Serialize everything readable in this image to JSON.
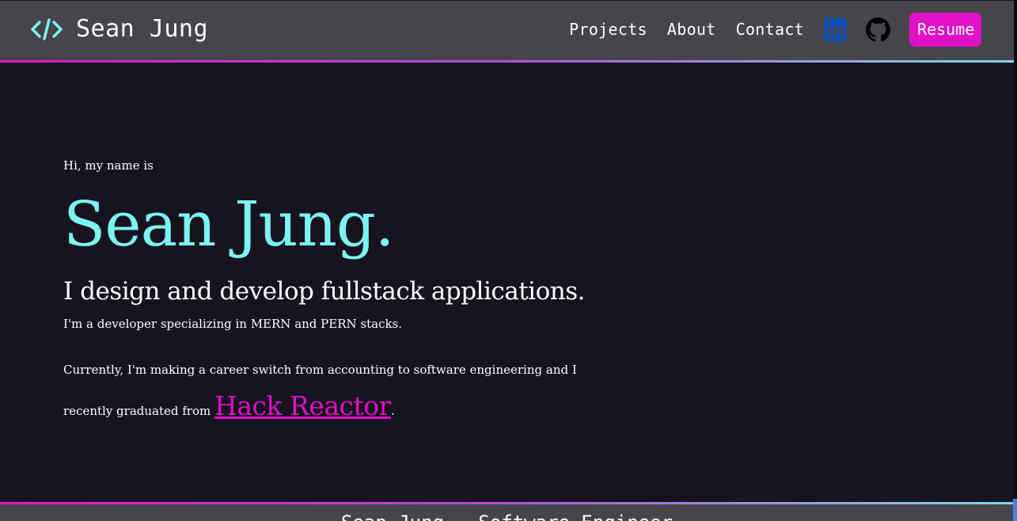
{
  "header": {
    "brand_name": "Sean Jung",
    "brand_icon": "code-icon",
    "nav": [
      {
        "label": "Projects"
      },
      {
        "label": "About"
      },
      {
        "label": "Contact"
      }
    ],
    "social_icons": [
      "linkedin-icon",
      "github-icon"
    ],
    "resume_label": "Resume"
  },
  "hero": {
    "greeting": "Hi, my name is",
    "name": "Sean Jung.",
    "tagline": "I design and develop fullstack applications.",
    "description": "I'm a developer specializing in MERN and PERN stacks.",
    "bio_prefix": "Currently, I'm making a career switch from accounting to software engineering and I recently graduated from",
    "bio_link": "Hack Reactor",
    "bio_suffix": "."
  },
  "footer": {
    "text": "Sean Jung - Software Engineer"
  },
  "colors": {
    "background": "#17141f",
    "header_bg": "#46454b",
    "accent_cyan": "#7cf4f4",
    "accent_magenta": "#e010c8",
    "linkedin_blue": "#0a4fb3"
  }
}
